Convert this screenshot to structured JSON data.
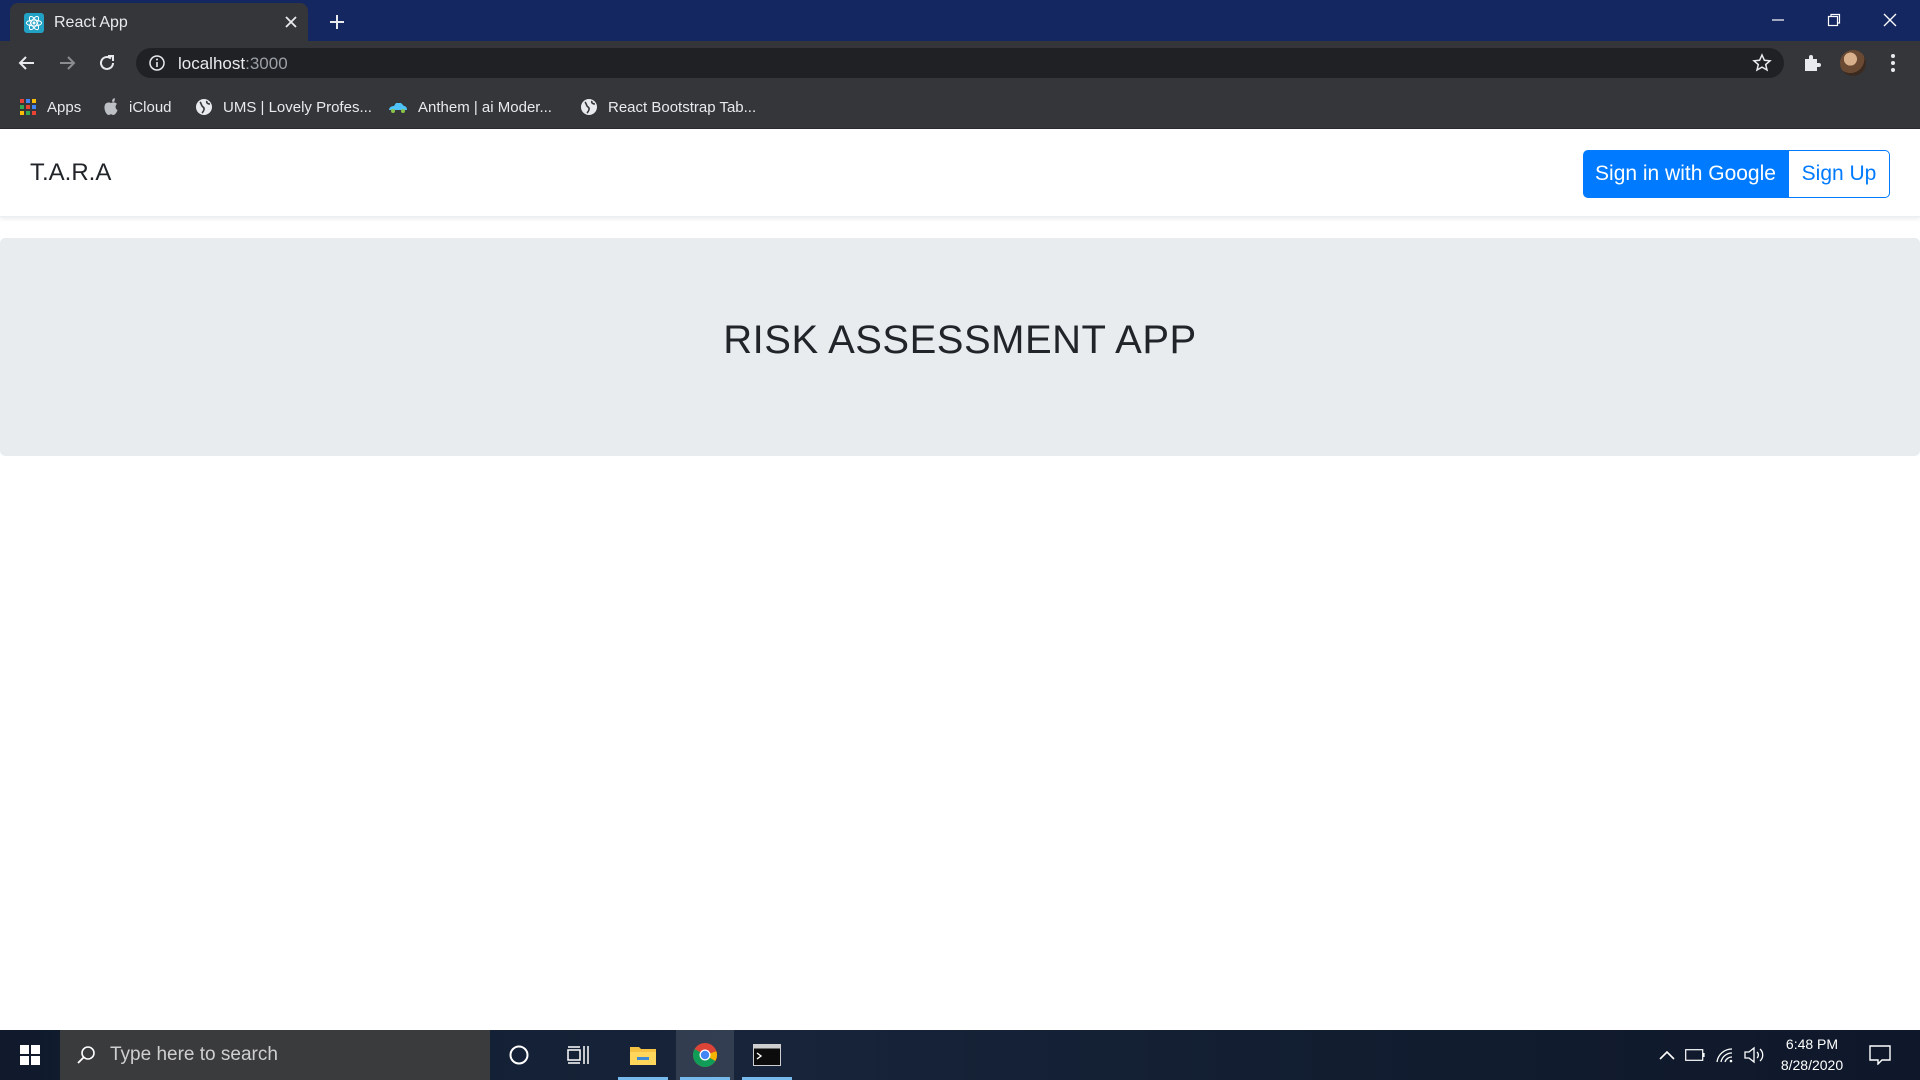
{
  "browser": {
    "tab_title": "React App",
    "url_host": "localhost",
    "url_port": ":3000",
    "bookmarks": [
      {
        "label": "Apps",
        "icon": "apps-grid-icon"
      },
      {
        "label": "iCloud",
        "icon": "apple-icon"
      },
      {
        "label": "UMS | Lovely Profes...",
        "icon": "globe-icon"
      },
      {
        "label": "Anthem | ai Moder...",
        "icon": "car-icon"
      },
      {
        "label": "React Bootstrap Tab...",
        "icon": "globe-icon"
      }
    ]
  },
  "navbar": {
    "brand": "T.A.R.A",
    "google_button": "Sign in with Google",
    "signup_button": "Sign Up"
  },
  "hero": {
    "title": "RISK ASSESSMENT APP"
  },
  "taskbar": {
    "search_placeholder": "Type here to search",
    "time": "6:48 PM",
    "date": "8/28/2020"
  },
  "colors": {
    "primary": "#007bff",
    "jumbotron_bg": "#e9ecef",
    "tabstrip_bg": "#142760",
    "toolbar_bg": "#35363a"
  }
}
